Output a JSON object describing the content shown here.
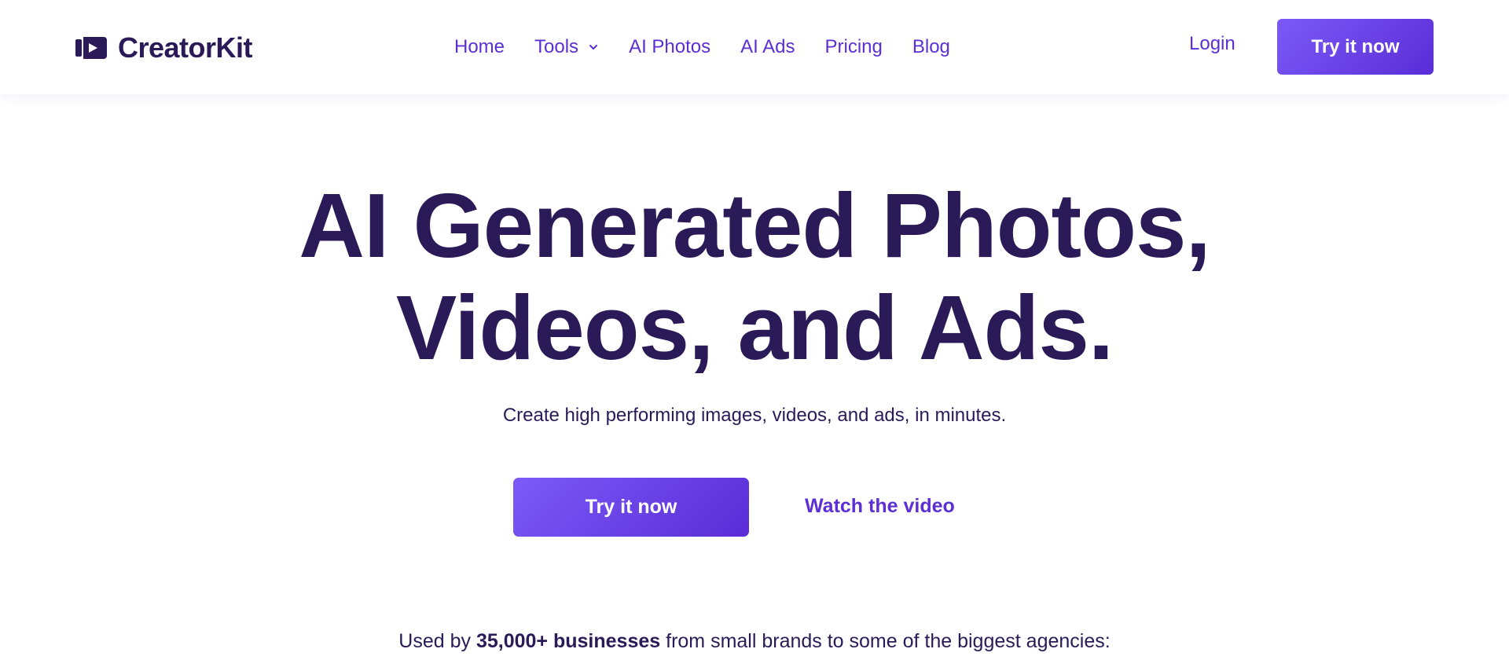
{
  "brand": {
    "name": "CreatorKit",
    "icon": "video-play-icon",
    "primary_color": "#2a1a58",
    "accent_color": "#5b2fd3",
    "gradient_start": "#7b5af8",
    "gradient_end": "#5a2dd6"
  },
  "nav": {
    "items": [
      {
        "label": "Home"
      },
      {
        "label": "Tools",
        "has_dropdown": true,
        "icon": "chevron-down-icon"
      },
      {
        "label": "AI Photos"
      },
      {
        "label": "AI Ads"
      },
      {
        "label": "Pricing"
      },
      {
        "label": "Blog"
      }
    ],
    "login_label": "Login",
    "cta_label": "Try it now"
  },
  "hero": {
    "title_line1": "AI Generated Photos,",
    "title_line2": "Videos, and Ads.",
    "subtitle": "Create high performing images, videos, and ads, in minutes.",
    "cta_label": "Try it now",
    "secondary_label": "Watch the video"
  },
  "social_proof": {
    "prefix": "Used by ",
    "highlight": "35,000+ businesses",
    "suffix": " from small brands to some of the biggest agencies:"
  }
}
